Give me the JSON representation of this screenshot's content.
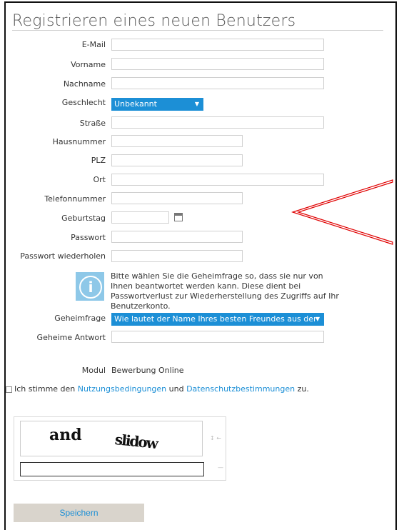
{
  "page": {
    "title": "Registrieren eines neuen Benutzers"
  },
  "form": {
    "email_label": "E-Mail",
    "vorname_label": "Vorname",
    "nachname_label": "Nachname",
    "geschlecht_label": "Geschlecht",
    "geschlecht_value": "Unbekannt",
    "strasse_label": "Straße",
    "hausnummer_label": "Hausnummer",
    "plz_label": "PLZ",
    "ort_label": "Ort",
    "telefon_label": "Telefonnummer",
    "geburtstag_label": "Geburtstag",
    "passwort_label": "Passwort",
    "passwort_wdh_label": "Passwort wiederholen",
    "info_text": "Bitte wählen Sie die Geheimfrage so, dass sie nur von Ihnen beantwortet werden kann. Diese dient bei Passwortverlust zur Wiederherstellung des Zugriffs auf Ihr Benutzerkonto.",
    "geheimfrage_label": "Geheimfrage",
    "geheimfrage_value": "Wie lautet der Name Ihres besten Freundes aus der Ki...",
    "geheime_antwort_label": "Geheime Antwort",
    "modul_label": "Modul",
    "modul_value": "Bewerbung Online"
  },
  "agreement": {
    "prefix": "Ich stimme den ",
    "terms_link": "Nutzungsbedingungen",
    "middle": " und ",
    "privacy_link": "Datenschutzbestimmungen",
    "suffix": " zu."
  },
  "captcha": {
    "word1": "and",
    "word2": "slidow"
  },
  "actions": {
    "save_label": "Speichern"
  },
  "colors": {
    "accent": "#1c8fd6",
    "annotation_arrow": "#e00000",
    "button_bg": "#d9d4cc"
  },
  "icons": {
    "info": "info-icon",
    "calendar": "calendar-icon",
    "dropdown": "chevron-down-icon"
  }
}
